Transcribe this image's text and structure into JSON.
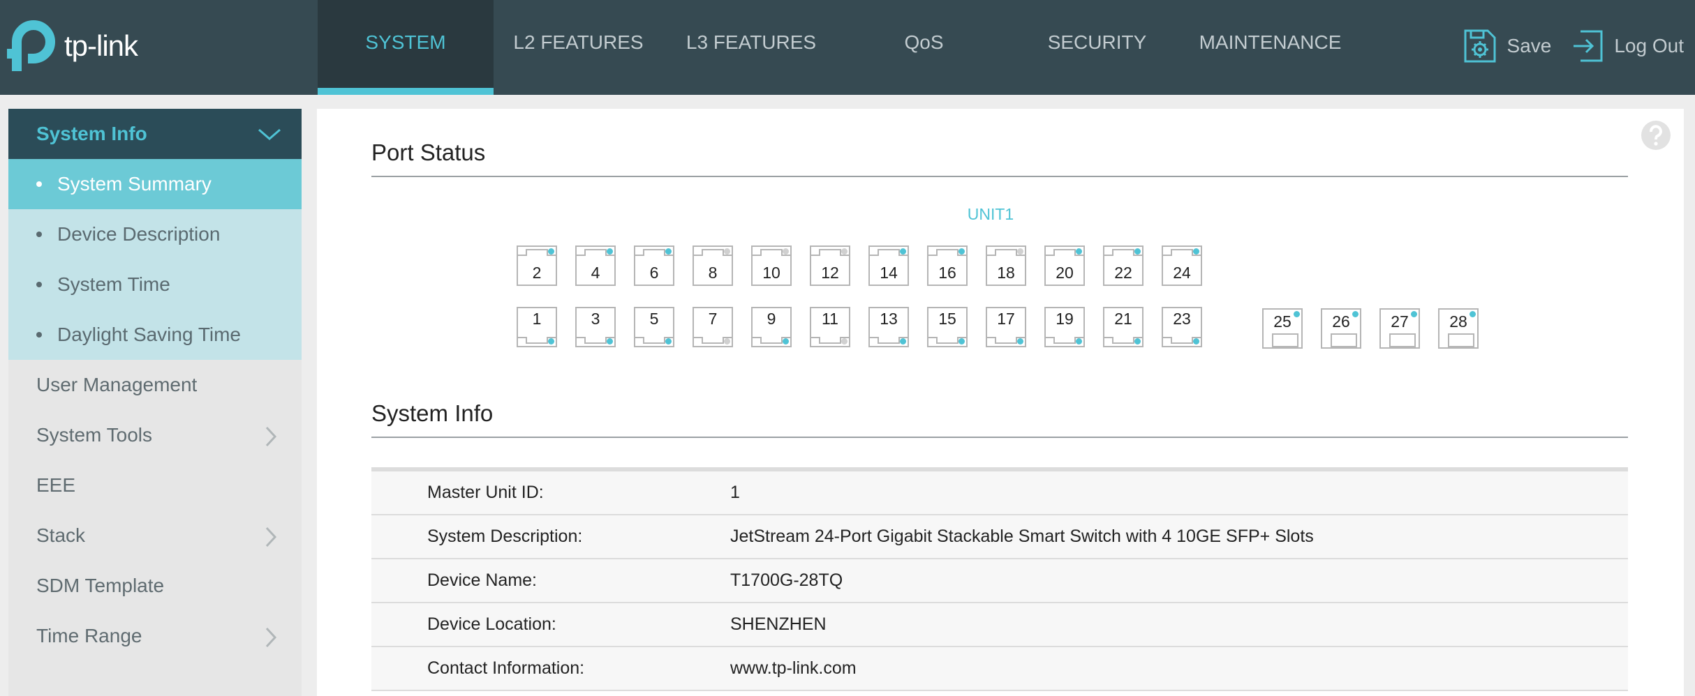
{
  "brand": {
    "name": "tp-link",
    "colors": {
      "topbar": "#364a52",
      "accent": "#4fc3d5",
      "led_on": "#4fc3d5",
      "led_off": "#d0d0d0"
    }
  },
  "nav": {
    "tabs": [
      {
        "label": "SYSTEM",
        "active": true
      },
      {
        "label": "L2 FEATURES",
        "active": false
      },
      {
        "label": "L3 FEATURES",
        "active": false
      },
      {
        "label": "QoS",
        "active": false
      },
      {
        "label": "SECURITY",
        "active": false
      },
      {
        "label": "MAINTENANCE",
        "active": false
      }
    ],
    "save_label": "Save",
    "save_icon": "save-gear-icon",
    "logout_label": "Log Out",
    "logout_icon": "logout-icon"
  },
  "sidebar": {
    "header": {
      "label": "System Info",
      "icon": "chevron-down-icon"
    },
    "subitems": [
      {
        "label": "System Summary",
        "active": true
      },
      {
        "label": "Device Description",
        "active": false
      },
      {
        "label": "System Time",
        "active": false
      },
      {
        "label": "Daylight Saving Time",
        "active": false
      }
    ],
    "items": [
      {
        "label": "User Management",
        "has_children": false
      },
      {
        "label": "System Tools",
        "has_children": true
      },
      {
        "label": "EEE",
        "has_children": false
      },
      {
        "label": "Stack",
        "has_children": true
      },
      {
        "label": "SDM Template",
        "has_children": false
      },
      {
        "label": "Time Range",
        "has_children": true
      }
    ]
  },
  "main": {
    "help_icon": "question-mark-icon",
    "port_status": {
      "title": "Port Status",
      "unit_label": "UNIT1",
      "top_row": [
        {
          "label": "2",
          "link_up": true
        },
        {
          "label": "4",
          "link_up": true
        },
        {
          "label": "6",
          "link_up": true
        },
        {
          "label": "8",
          "link_up": false
        },
        {
          "label": "10",
          "link_up": false
        },
        {
          "label": "12",
          "link_up": false
        },
        {
          "label": "14",
          "link_up": true
        },
        {
          "label": "16",
          "link_up": true
        },
        {
          "label": "18",
          "link_up": false
        },
        {
          "label": "20",
          "link_up": true
        },
        {
          "label": "22",
          "link_up": true
        },
        {
          "label": "24",
          "link_up": true
        }
      ],
      "bottom_row": [
        {
          "label": "1",
          "link_up": true
        },
        {
          "label": "3",
          "link_up": true
        },
        {
          "label": "5",
          "link_up": true
        },
        {
          "label": "7",
          "link_up": false
        },
        {
          "label": "9",
          "link_up": true
        },
        {
          "label": "11",
          "link_up": false
        },
        {
          "label": "13",
          "link_up": true
        },
        {
          "label": "15",
          "link_up": true
        },
        {
          "label": "17",
          "link_up": true
        },
        {
          "label": "19",
          "link_up": true
        },
        {
          "label": "21",
          "link_up": true
        },
        {
          "label": "23",
          "link_up": true
        }
      ],
      "sfp_ports": [
        {
          "label": "25",
          "link_up": true
        },
        {
          "label": "26",
          "link_up": true
        },
        {
          "label": "27",
          "link_up": true
        },
        {
          "label": "28",
          "link_up": true
        }
      ]
    },
    "system_info": {
      "title": "System Info",
      "rows": [
        {
          "key": "Master Unit ID:",
          "value": "1"
        },
        {
          "key": "System Description:",
          "value": "JetStream 24-Port Gigabit Stackable Smart Switch with 4 10GE SFP+ Slots"
        },
        {
          "key": "Device Name:",
          "value": "T1700G-28TQ"
        },
        {
          "key": "Device Location:",
          "value": "SHENZHEN"
        },
        {
          "key": "Contact Information:",
          "value": "www.tp-link.com"
        }
      ]
    }
  }
}
